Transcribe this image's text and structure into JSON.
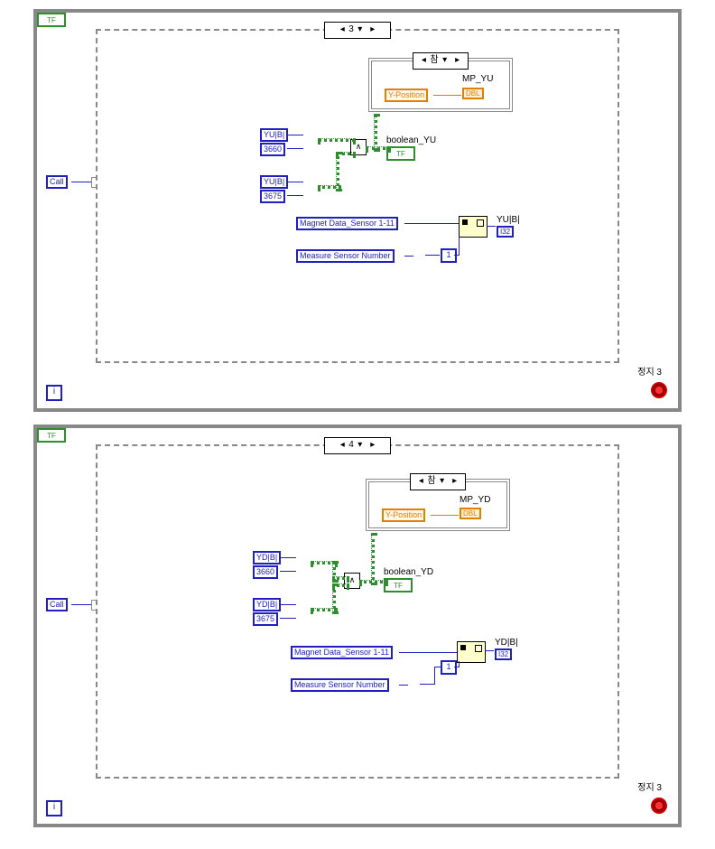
{
  "top": {
    "caseIndex": "3",
    "innerCase": "참",
    "mpLabel": "MP_YU",
    "yPos": "Y-Position",
    "dbl": "DBL",
    "inA": "YU|B|",
    "constA": "3660",
    "inB": "YU|B|",
    "constB": "3675",
    "andOp": "∧",
    "boolOut": "boolean_YU",
    "tf": "TF",
    "magnet": "Magnet Data_Sensor 1-11",
    "measure": "Measure Sensor Number",
    "subConst": "1",
    "outArr": "YU|B|",
    "i32": "I32",
    "iter": "i",
    "call": "Call",
    "stopLbl": "정지 3",
    "stopTf": "TF"
  },
  "bot": {
    "caseIndex": "4",
    "innerCase": "참",
    "mpLabel": "MP_YD",
    "yPos": "Y-Position",
    "dbl": "DBL",
    "inA": "YD|B|",
    "constA": "3660",
    "inB": "YD|B|",
    "constB": "3675",
    "andOp": "∧",
    "boolOut": "boolean_YD",
    "tf": "TF",
    "magnet": "Magnet Data_Sensor 1-11",
    "measure": "Measure Sensor Number",
    "subConst": "1",
    "outArr": "YD|B|",
    "i32": "I32",
    "iter": "i",
    "call": "Call",
    "stopLbl": "정지 3",
    "stopTf": "TF"
  }
}
